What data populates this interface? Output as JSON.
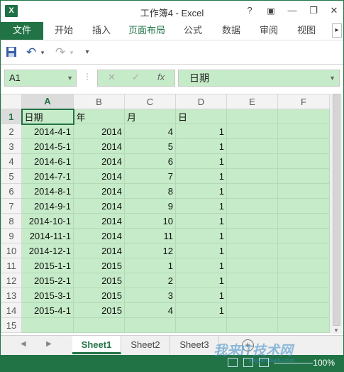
{
  "window": {
    "app_icon": "X",
    "title": "工作簿4 - Excel",
    "help_icon": "?",
    "ribbon_options_icon": "▣",
    "minimize_icon": "—",
    "restore_icon": "❐",
    "close_icon": "✕"
  },
  "ribbon": {
    "tabs": [
      "文件",
      "开始",
      "插入",
      "页面布局",
      "公式",
      "数据",
      "审阅",
      "视图"
    ],
    "active_tab": "页面布局",
    "scroll_right": "▸"
  },
  "qat": {
    "save": "💾",
    "undo": "↶",
    "redo": "↷",
    "customize": "▾"
  },
  "formula_bar": {
    "name_box": "A1",
    "cancel": "✕",
    "enter": "✓",
    "fx": "fx",
    "value": "日期"
  },
  "grid": {
    "columns": [
      "A",
      "B",
      "C",
      "D",
      "E",
      "F"
    ],
    "selected_col": "A",
    "selected_row": 1,
    "rows": [
      {
        "r": "1",
        "cells": [
          "日期",
          "年",
          "月",
          "日",
          "",
          ""
        ]
      },
      {
        "r": "2",
        "cells": [
          "2014-4-1",
          "2014",
          "4",
          "1",
          "",
          ""
        ]
      },
      {
        "r": "3",
        "cells": [
          "2014-5-1",
          "2014",
          "5",
          "1",
          "",
          ""
        ]
      },
      {
        "r": "4",
        "cells": [
          "2014-6-1",
          "2014",
          "6",
          "1",
          "",
          ""
        ]
      },
      {
        "r": "5",
        "cells": [
          "2014-7-1",
          "2014",
          "7",
          "1",
          "",
          ""
        ]
      },
      {
        "r": "6",
        "cells": [
          "2014-8-1",
          "2014",
          "8",
          "1",
          "",
          ""
        ]
      },
      {
        "r": "7",
        "cells": [
          "2014-9-1",
          "2014",
          "9",
          "1",
          "",
          ""
        ]
      },
      {
        "r": "8",
        "cells": [
          "2014-10-1",
          "2014",
          "10",
          "1",
          "",
          ""
        ]
      },
      {
        "r": "9",
        "cells": [
          "2014-11-1",
          "2014",
          "11",
          "1",
          "",
          ""
        ]
      },
      {
        "r": "10",
        "cells": [
          "2014-12-1",
          "2014",
          "12",
          "1",
          "",
          ""
        ]
      },
      {
        "r": "11",
        "cells": [
          "2015-1-1",
          "2015",
          "1",
          "1",
          "",
          ""
        ]
      },
      {
        "r": "12",
        "cells": [
          "2015-2-1",
          "2015",
          "2",
          "1",
          "",
          ""
        ]
      },
      {
        "r": "13",
        "cells": [
          "2015-3-1",
          "2015",
          "3",
          "1",
          "",
          ""
        ]
      },
      {
        "r": "14",
        "cells": [
          "2015-4-1",
          "2015",
          "4",
          "1",
          "",
          ""
        ]
      },
      {
        "r": "15",
        "cells": [
          "",
          "",
          "",
          "",
          "",
          ""
        ]
      }
    ]
  },
  "sheets": {
    "tabs": [
      "Sheet1",
      "Sheet2",
      "Sheet3"
    ],
    "active": "Sheet1",
    "add": "+"
  },
  "status": {
    "zoom": "100%"
  },
  "watermark": {
    "text": "我来IT技术网",
    "url": "jingyan.baidu.com"
  },
  "colors": {
    "accent": "#217346",
    "cell_fill": "#c6ebc8"
  }
}
